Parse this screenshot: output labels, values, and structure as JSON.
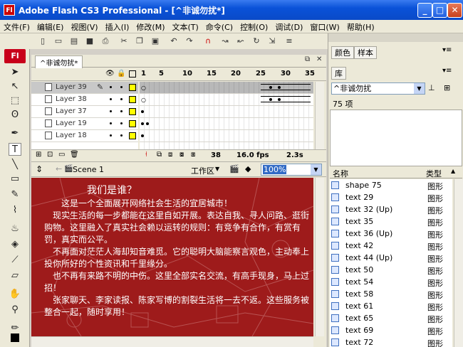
{
  "window": {
    "title": "Adobe Flash CS3 Professional - [^非诚勿扰*]",
    "app_icon": "Fl"
  },
  "menu": [
    "文件(F)",
    "编辑(E)",
    "视图(V)",
    "插入(I)",
    "修改(M)",
    "文本(T)",
    "命令(C)",
    "控制(O)",
    "调试(D)",
    "窗口(W)",
    "帮助(H)"
  ],
  "tools": {
    "badge": "Fl"
  },
  "document": {
    "tab": "^非诚勿扰*"
  },
  "timeline": {
    "frame_numbers": [
      "1",
      "5",
      "10",
      "15",
      "20",
      "25",
      "30",
      "35"
    ],
    "layers": [
      {
        "name": "Layer 39",
        "selected": true
      },
      {
        "name": "Layer 38",
        "selected": false
      },
      {
        "name": "Layer 37",
        "selected": false
      },
      {
        "name": "Layer 19",
        "selected": false
      },
      {
        "name": "Layer 18",
        "selected": false
      }
    ],
    "current_frame": "38",
    "fps": "16.0 fps",
    "time": "2.3s"
  },
  "editbar": {
    "scene": "Scene 1",
    "workarea": "工作区",
    "zoom": "100%"
  },
  "stage": {
    "heading": "我们是谁？",
    "paragraphs": [
      "这是一个全面展开网络社会生活的宜居城市！",
      "现实生活的每一步都能在这里自如开展。表达自我、寻人问路、逛街购物。这里融入了真实社会赖以运转的规则：有竞争有合作，有赏有罚，真实而公平。",
      "不再面对茫茫人海却知音难觅。它的聪明大脑能察言观色，主动奉上投你所好的个性资讯和千里缘分。",
      "也不再有来路不明的中伤。这里全部实名交流，有高手现身，马上过招！",
      "张家聊天、李家读报、陈家写博的割裂生活将一去不返。这些服务被整合一起，随时享用！"
    ]
  },
  "panels": {
    "color_tabs": [
      "颜色",
      "样本"
    ],
    "library_tab": "库",
    "library_select": "^非诚勿扰",
    "library_count": "75 项",
    "columns": {
      "name": "名称",
      "type": "类型"
    },
    "items": [
      {
        "name": "shape 75",
        "type": "图形"
      },
      {
        "name": "text 29",
        "type": "图形"
      },
      {
        "name": "text 32 (Up)",
        "type": "图形"
      },
      {
        "name": "text 35",
        "type": "图形"
      },
      {
        "name": "text 36 (Up)",
        "type": "图形"
      },
      {
        "name": "text 42",
        "type": "图形"
      },
      {
        "name": "text 44 (Up)",
        "type": "图形"
      },
      {
        "name": "text 50",
        "type": "图形"
      },
      {
        "name": "text 54",
        "type": "图形"
      },
      {
        "name": "text 58",
        "type": "图形"
      },
      {
        "name": "text 61",
        "type": "图形"
      },
      {
        "name": "text 65",
        "type": "图形"
      },
      {
        "name": "text 69",
        "type": "图形"
      },
      {
        "name": "text 72",
        "type": "图形"
      }
    ]
  }
}
